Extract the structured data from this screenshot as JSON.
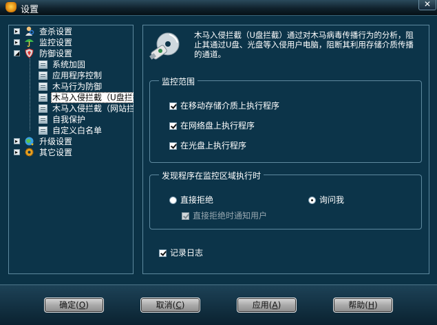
{
  "window": {
    "title": "设置"
  },
  "tree": {
    "items": [
      {
        "label": "查杀设置",
        "icon": "person-scan-icon"
      },
      {
        "label": "监控设置",
        "icon": "umbrella-icon"
      },
      {
        "label": "防御设置",
        "icon": "shield-icon",
        "children": [
          "系统加固",
          "应用程序控制",
          "木马行为防御",
          "木马入侵拦截（U盘拦截",
          "木马入侵拦截（网站拦",
          "自我保护",
          "自定义白名单"
        ]
      },
      {
        "label": "升级设置",
        "icon": "globe-update-icon"
      },
      {
        "label": "其它设置",
        "icon": "gear-icon"
      }
    ],
    "selected": "木马入侵拦截（U盘拦截"
  },
  "content": {
    "description": "木马入侵拦截（U盘拦截）通过对木马病毒传播行为的分析，阻止其通过U盘、光盘等入侵用户电脑，阻断其利用存储介质传播的通道。",
    "monitor_scope": {
      "title": "监控范围",
      "options": [
        {
          "label": "在移动存储介质上执行程序",
          "checked": true
        },
        {
          "label": "在网络盘上执行程序",
          "checked": true
        },
        {
          "label": "在光盘上执行程序",
          "checked": true
        }
      ]
    },
    "on_detect": {
      "title": "发现程序在监控区域执行时",
      "reject_label": "直接拒绝",
      "ask_label": "询问我",
      "selected": "询问我",
      "notify_label": "直接拒绝时通知用户",
      "notify_checked": true,
      "notify_enabled": false
    },
    "log": {
      "label": "记录日志",
      "checked": true
    }
  },
  "buttons": {
    "ok": {
      "label": "确定",
      "key": "O"
    },
    "cancel": {
      "label": "取消",
      "key": "C"
    },
    "apply": {
      "label": "应用",
      "key": "A"
    },
    "help": {
      "label": "帮助",
      "key": "H"
    }
  }
}
